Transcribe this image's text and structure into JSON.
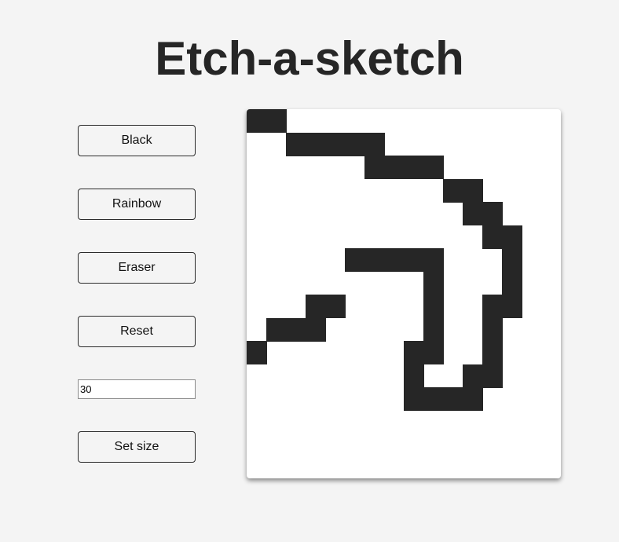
{
  "page": {
    "title": "Etch-a-sketch"
  },
  "controls": {
    "black_label": "Black",
    "rainbow_label": "Rainbow",
    "eraser_label": "Eraser",
    "reset_label": "Reset",
    "size_value": "30",
    "set_size_label": "Set size"
  },
  "board": {
    "background_color": "#ffffff",
    "ink_color": "#262626",
    "filled_cells": [
      [
        0,
        0
      ],
      [
        0,
        1
      ],
      [
        1,
        2
      ],
      [
        1,
        3
      ],
      [
        1,
        4
      ],
      [
        1,
        5
      ],
      [
        1,
        6
      ],
      [
        2,
        6
      ],
      [
        2,
        7
      ],
      [
        2,
        8
      ],
      [
        2,
        9
      ],
      [
        3,
        10
      ],
      [
        3,
        11
      ],
      [
        4,
        11
      ],
      [
        4,
        12
      ],
      [
        5,
        12
      ],
      [
        5,
        13
      ],
      [
        6,
        5
      ],
      [
        6,
        6
      ],
      [
        6,
        7
      ],
      [
        6,
        8
      ],
      [
        6,
        9
      ],
      [
        6,
        13
      ],
      [
        7,
        9
      ],
      [
        7,
        13
      ],
      [
        8,
        3
      ],
      [
        8,
        4
      ],
      [
        8,
        9
      ],
      [
        8,
        12
      ],
      [
        8,
        13
      ],
      [
        9,
        1
      ],
      [
        9,
        2
      ],
      [
        9,
        3
      ],
      [
        9,
        9
      ],
      [
        9,
        12
      ],
      [
        10,
        0
      ],
      [
        10,
        8
      ],
      [
        10,
        9
      ],
      [
        10,
        12
      ],
      [
        11,
        8
      ],
      [
        11,
        11
      ],
      [
        11,
        12
      ],
      [
        12,
        8
      ],
      [
        12,
        9
      ],
      [
        12,
        10
      ],
      [
        12,
        11
      ]
    ]
  }
}
